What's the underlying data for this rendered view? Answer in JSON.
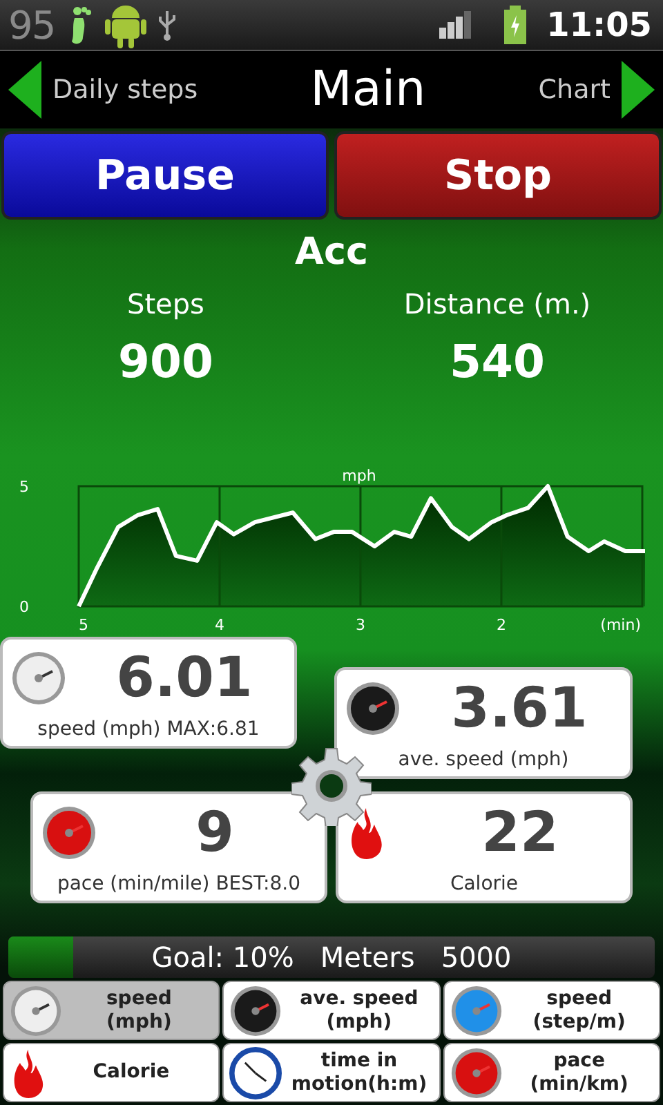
{
  "status_bar": {
    "step_count": "95",
    "time": "11:05"
  },
  "header": {
    "left": "Daily steps",
    "title": "Main",
    "right": "Chart"
  },
  "buttons": [
    {
      "label": "Pause",
      "kind": "pause"
    },
    {
      "label": "Stop",
      "kind": "stop"
    }
  ],
  "sensor": "Acc",
  "stats": [
    {
      "label": "Steps",
      "value": "900"
    },
    {
      "label": "Distance (m.)",
      "value": "540"
    }
  ],
  "chart_data": {
    "type": "area",
    "grid": true,
    "xlabel": "(min)",
    "xlim": [
      5,
      0.98
    ],
    "ylim": [
      0,
      5
    ],
    "xticks": [
      5,
      4,
      3,
      2
    ],
    "yticks": [
      0,
      5
    ],
    "x": [
      5,
      4.87,
      4.72,
      4.58,
      4.44,
      4.31,
      4.16,
      4.02,
      3.9,
      3.75,
      3.48,
      3.32,
      3.19,
      3.06,
      2.9,
      2.76,
      2.64,
      2.5,
      2.35,
      2.23,
      2.07,
      1.96,
      1.81,
      1.67,
      1.53,
      1.38,
      1.27,
      1.12,
      0.98
    ],
    "series": [
      {
        "name": "mph",
        "color": "#ffffff",
        "values": [
          0,
          1.6,
          3.3,
          3.8,
          4.05,
          2.1,
          1.9,
          3.5,
          3.0,
          3.5,
          3.9,
          2.8,
          3.1,
          3.1,
          2.5,
          3.1,
          2.9,
          4.5,
          3.3,
          2.8,
          3.5,
          3.8,
          4.1,
          5,
          2.9,
          2.3,
          2.7,
          2.3,
          2.3
        ]
      }
    ]
  },
  "cards": [
    {
      "kind": "gauge_white",
      "value": "6.01",
      "label": "speed (mph) MAX:6.81"
    },
    {
      "kind": "gauge_black",
      "value": "3.61",
      "label": "ave. speed (mph)"
    },
    {
      "kind": "gauge_red",
      "value": "9",
      "label": "pace (min/mile) BEST:8.0"
    },
    {
      "kind": "flame",
      "value": "22",
      "label": "Calorie"
    }
  ],
  "goal": {
    "text": "Goal: 10%   Meters   5000",
    "level": 0.1
  },
  "selector": [
    {
      "kind": "gauge_white",
      "label": "speed\n(mph)",
      "selected": true
    },
    {
      "kind": "gauge_black",
      "label": "ave. speed\n(mph)",
      "selected": false
    },
    {
      "kind": "gauge_blue",
      "label": "speed\n(step/m)",
      "selected": false
    },
    {
      "kind": "flame",
      "label": "Calorie",
      "selected": false
    },
    {
      "kind": "clock",
      "label": "time in\nmotion(h:m)",
      "selected": false
    },
    {
      "kind": "gauge_red",
      "label": "pace\n(min/km)",
      "selected": false
    }
  ]
}
